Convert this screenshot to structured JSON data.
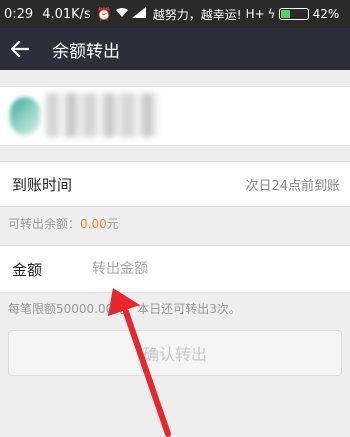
{
  "status_bar": {
    "time": "0:29",
    "speed": "4.01K/s",
    "carrier": "越努力，越幸运!",
    "network": "H+",
    "battery_percent": "42%",
    "battery_level": 0.42,
    "icons": [
      "alarm-icon",
      "wifi-icon",
      "signal-icon",
      "charging-icon"
    ]
  },
  "header": {
    "back_icon": "back-arrow-icon",
    "title": "余额转出"
  },
  "account": {
    "avatar": "avatar"
  },
  "arrival": {
    "label": "到账时间",
    "value": "次日24点前到账"
  },
  "available": {
    "prefix": "可转出余额：",
    "amount": "0.00",
    "unit": "元"
  },
  "amount_field": {
    "label": "金额",
    "placeholder": "转出金额",
    "value": ""
  },
  "limit_note": "每笔限额50000.00元，本日还可转出3次。",
  "confirm_button": {
    "label": "确认转出"
  },
  "colors": {
    "header_bg": "#2b2f3a",
    "status_bg": "#2a2a2a",
    "accent_orange": "#f08a2c",
    "annotation_red": "#e8262b"
  }
}
